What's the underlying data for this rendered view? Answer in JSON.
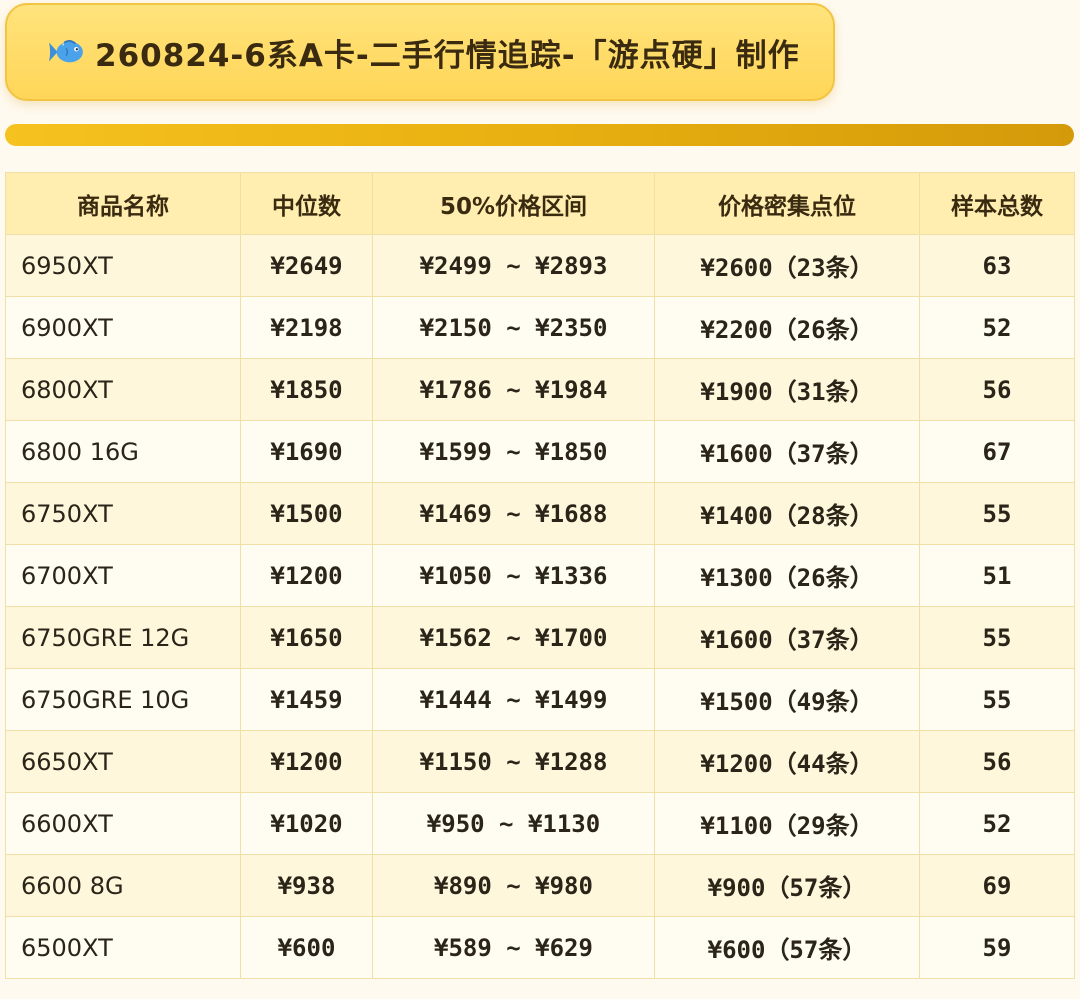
{
  "header": {
    "icon": "fish-icon",
    "title": "260824-6系A卡-二手行情追踪-「游点硬」制作"
  },
  "table": {
    "columns": [
      "商品名称",
      "中位数",
      "50%价格区间",
      "价格密集点位",
      "样本总数"
    ],
    "rows": [
      {
        "name": "6950XT",
        "median": "¥2649",
        "range": "¥2499 ~ ¥2893",
        "dense": "¥2600（23条）",
        "samples": "63"
      },
      {
        "name": "6900XT",
        "median": "¥2198",
        "range": "¥2150 ~ ¥2350",
        "dense": "¥2200（26条）",
        "samples": "52"
      },
      {
        "name": "6800XT",
        "median": "¥1850",
        "range": "¥1786 ~ ¥1984",
        "dense": "¥1900（31条）",
        "samples": "56"
      },
      {
        "name": "6800 16G",
        "median": "¥1690",
        "range": "¥1599 ~ ¥1850",
        "dense": "¥1600（37条）",
        "samples": "67"
      },
      {
        "name": "6750XT",
        "median": "¥1500",
        "range": "¥1469 ~ ¥1688",
        "dense": "¥1400（28条）",
        "samples": "55"
      },
      {
        "name": "6700XT",
        "median": "¥1200",
        "range": "¥1050 ~ ¥1336",
        "dense": "¥1300（26条）",
        "samples": "51"
      },
      {
        "name": "6750GRE 12G",
        "median": "¥1650",
        "range": "¥1562 ~ ¥1700",
        "dense": "¥1600（37条）",
        "samples": "55"
      },
      {
        "name": "6750GRE 10G",
        "median": "¥1459",
        "range": "¥1444 ~ ¥1499",
        "dense": "¥1500（49条）",
        "samples": "55"
      },
      {
        "name": "6650XT",
        "median": "¥1200",
        "range": "¥1150 ~ ¥1288",
        "dense": "¥1200（44条）",
        "samples": "56"
      },
      {
        "name": "6600XT",
        "median": "¥1020",
        "range": "¥950 ~ ¥1130",
        "dense": "¥1100（29条）",
        "samples": "52"
      },
      {
        "name": "6600 8G",
        "median": "¥938",
        "range": "¥890 ~ ¥980",
        "dense": "¥900（57条）",
        "samples": "69"
      },
      {
        "name": "6500XT",
        "median": "¥600",
        "range": "¥589 ~ ¥629",
        "dense": "¥600（57条）",
        "samples": "59"
      }
    ]
  },
  "colors": {
    "title_bg": "#ffd658",
    "bar": "#e8b010",
    "header_bg": "#ffeeb0",
    "row_odd": "#fff7dc",
    "row_even": "#fffcf2"
  }
}
